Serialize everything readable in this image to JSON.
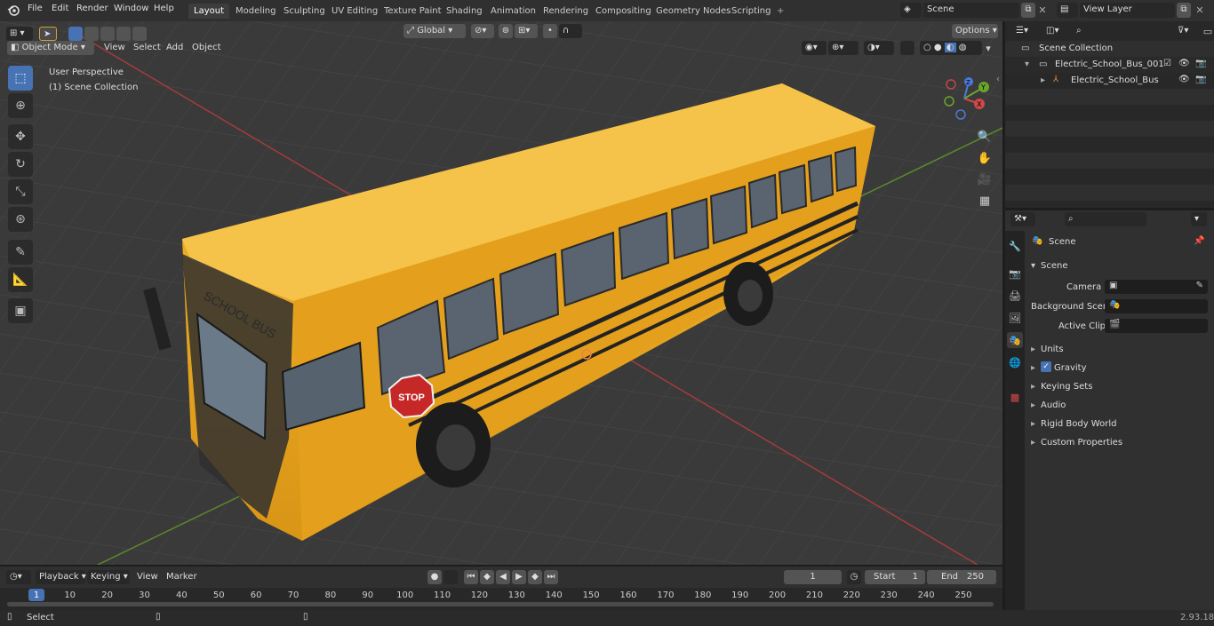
{
  "topbar": {
    "menus": [
      "File",
      "Edit",
      "Render",
      "Window",
      "Help"
    ],
    "workspaces": [
      "Layout",
      "Modeling",
      "Sculpting",
      "UV Editing",
      "Texture Paint",
      "Shading",
      "Animation",
      "Rendering",
      "Compositing",
      "Geometry Nodes",
      "Scripting"
    ],
    "active_workspace": "Layout",
    "scene_name": "Scene",
    "view_layer": "View Layer"
  },
  "viewport": {
    "mode": "Object Mode",
    "menus": [
      "View",
      "Select",
      "Add",
      "Object"
    ],
    "transform_orientation": "Global",
    "options_label": "Options",
    "info_line1": "User Perspective",
    "info_line2": "(1) Scene Collection",
    "gizmo": {
      "x": "X",
      "y": "Y",
      "z": "Z"
    },
    "stop_sign": "STOP",
    "bus_sign": "SCHOOL BUS"
  },
  "outliner": {
    "root": "Scene Collection",
    "items": [
      {
        "label": "Electric_School_Bus_001"
      },
      {
        "label": "Electric_School_Bus"
      }
    ]
  },
  "properties": {
    "header": "Scene",
    "panel": "Scene",
    "camera_label": "Camera",
    "background_scene_label": "Background Scene",
    "active_clip_label": "Active Clip",
    "subpanels": [
      "Units",
      "Gravity",
      "Keying Sets",
      "Audio",
      "Rigid Body World",
      "Custom Properties"
    ]
  },
  "timeline": {
    "menus": [
      "Playback",
      "Keying",
      "View",
      "Marker"
    ],
    "current_frame": "1",
    "start_label": "Start",
    "start_value": "1",
    "end_label": "End",
    "end_value": "250",
    "ticks": [
      "1",
      "10",
      "20",
      "30",
      "40",
      "50",
      "60",
      "70",
      "80",
      "90",
      "100",
      "110",
      "120",
      "130",
      "140",
      "150",
      "160",
      "170",
      "180",
      "190",
      "200",
      "210",
      "220",
      "230",
      "240",
      "250"
    ]
  },
  "statusbar": {
    "left": "Select",
    "version": "2.93.18"
  },
  "colors": {
    "accent": "#4772b3",
    "bus": "#e8a618",
    "grid_x": "#b5413d",
    "grid_y": "#6c9b2a"
  }
}
